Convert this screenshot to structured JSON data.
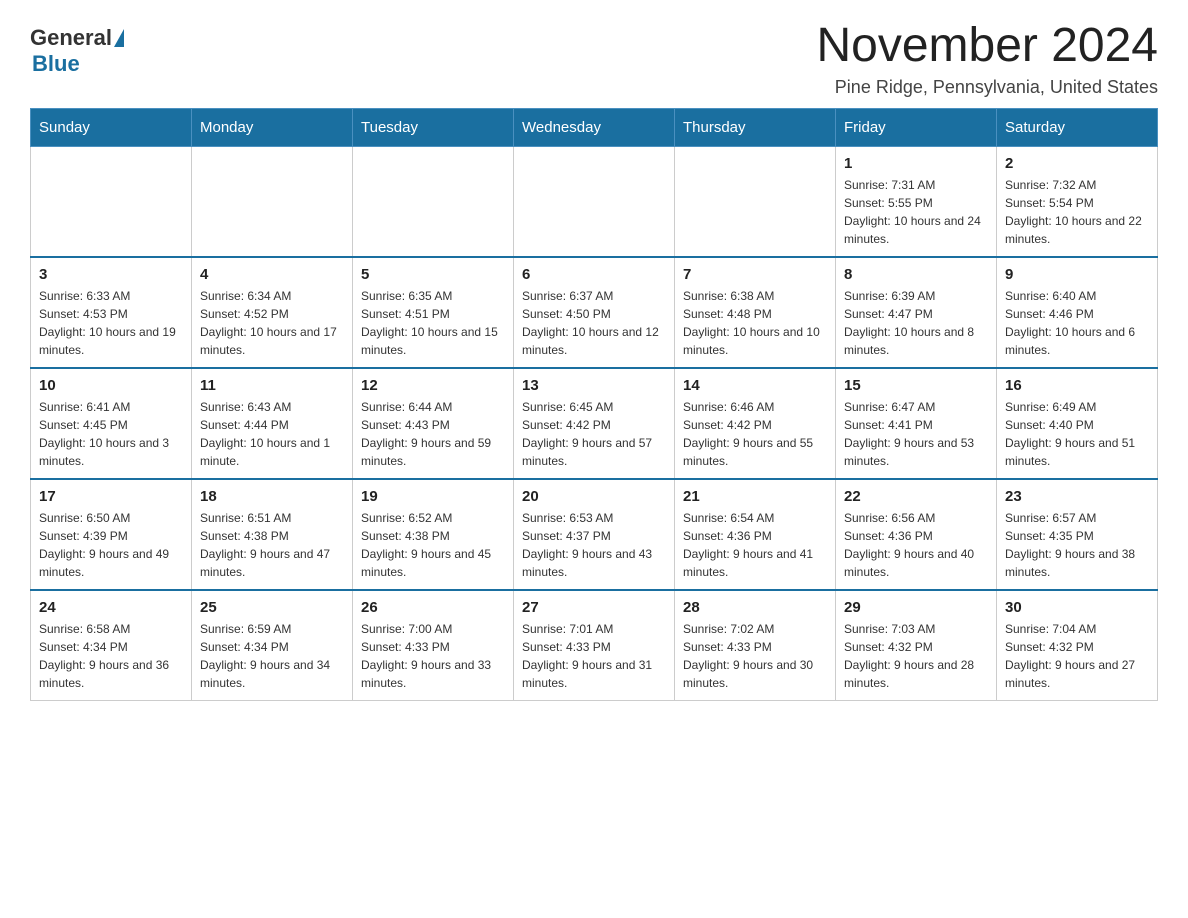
{
  "header": {
    "logo": {
      "general": "General",
      "blue": "Blue"
    },
    "title": "November 2024",
    "location": "Pine Ridge, Pennsylvania, United States"
  },
  "days_of_week": [
    "Sunday",
    "Monday",
    "Tuesday",
    "Wednesday",
    "Thursday",
    "Friday",
    "Saturday"
  ],
  "weeks": [
    [
      {
        "day": "",
        "info": ""
      },
      {
        "day": "",
        "info": ""
      },
      {
        "day": "",
        "info": ""
      },
      {
        "day": "",
        "info": ""
      },
      {
        "day": "",
        "info": ""
      },
      {
        "day": "1",
        "info": "Sunrise: 7:31 AM\nSunset: 5:55 PM\nDaylight: 10 hours and 24 minutes."
      },
      {
        "day": "2",
        "info": "Sunrise: 7:32 AM\nSunset: 5:54 PM\nDaylight: 10 hours and 22 minutes."
      }
    ],
    [
      {
        "day": "3",
        "info": "Sunrise: 6:33 AM\nSunset: 4:53 PM\nDaylight: 10 hours and 19 minutes."
      },
      {
        "day": "4",
        "info": "Sunrise: 6:34 AM\nSunset: 4:52 PM\nDaylight: 10 hours and 17 minutes."
      },
      {
        "day": "5",
        "info": "Sunrise: 6:35 AM\nSunset: 4:51 PM\nDaylight: 10 hours and 15 minutes."
      },
      {
        "day": "6",
        "info": "Sunrise: 6:37 AM\nSunset: 4:50 PM\nDaylight: 10 hours and 12 minutes."
      },
      {
        "day": "7",
        "info": "Sunrise: 6:38 AM\nSunset: 4:48 PM\nDaylight: 10 hours and 10 minutes."
      },
      {
        "day": "8",
        "info": "Sunrise: 6:39 AM\nSunset: 4:47 PM\nDaylight: 10 hours and 8 minutes."
      },
      {
        "day": "9",
        "info": "Sunrise: 6:40 AM\nSunset: 4:46 PM\nDaylight: 10 hours and 6 minutes."
      }
    ],
    [
      {
        "day": "10",
        "info": "Sunrise: 6:41 AM\nSunset: 4:45 PM\nDaylight: 10 hours and 3 minutes."
      },
      {
        "day": "11",
        "info": "Sunrise: 6:43 AM\nSunset: 4:44 PM\nDaylight: 10 hours and 1 minute."
      },
      {
        "day": "12",
        "info": "Sunrise: 6:44 AM\nSunset: 4:43 PM\nDaylight: 9 hours and 59 minutes."
      },
      {
        "day": "13",
        "info": "Sunrise: 6:45 AM\nSunset: 4:42 PM\nDaylight: 9 hours and 57 minutes."
      },
      {
        "day": "14",
        "info": "Sunrise: 6:46 AM\nSunset: 4:42 PM\nDaylight: 9 hours and 55 minutes."
      },
      {
        "day": "15",
        "info": "Sunrise: 6:47 AM\nSunset: 4:41 PM\nDaylight: 9 hours and 53 minutes."
      },
      {
        "day": "16",
        "info": "Sunrise: 6:49 AM\nSunset: 4:40 PM\nDaylight: 9 hours and 51 minutes."
      }
    ],
    [
      {
        "day": "17",
        "info": "Sunrise: 6:50 AM\nSunset: 4:39 PM\nDaylight: 9 hours and 49 minutes."
      },
      {
        "day": "18",
        "info": "Sunrise: 6:51 AM\nSunset: 4:38 PM\nDaylight: 9 hours and 47 minutes."
      },
      {
        "day": "19",
        "info": "Sunrise: 6:52 AM\nSunset: 4:38 PM\nDaylight: 9 hours and 45 minutes."
      },
      {
        "day": "20",
        "info": "Sunrise: 6:53 AM\nSunset: 4:37 PM\nDaylight: 9 hours and 43 minutes."
      },
      {
        "day": "21",
        "info": "Sunrise: 6:54 AM\nSunset: 4:36 PM\nDaylight: 9 hours and 41 minutes."
      },
      {
        "day": "22",
        "info": "Sunrise: 6:56 AM\nSunset: 4:36 PM\nDaylight: 9 hours and 40 minutes."
      },
      {
        "day": "23",
        "info": "Sunrise: 6:57 AM\nSunset: 4:35 PM\nDaylight: 9 hours and 38 minutes."
      }
    ],
    [
      {
        "day": "24",
        "info": "Sunrise: 6:58 AM\nSunset: 4:34 PM\nDaylight: 9 hours and 36 minutes."
      },
      {
        "day": "25",
        "info": "Sunrise: 6:59 AM\nSunset: 4:34 PM\nDaylight: 9 hours and 34 minutes."
      },
      {
        "day": "26",
        "info": "Sunrise: 7:00 AM\nSunset: 4:33 PM\nDaylight: 9 hours and 33 minutes."
      },
      {
        "day": "27",
        "info": "Sunrise: 7:01 AM\nSunset: 4:33 PM\nDaylight: 9 hours and 31 minutes."
      },
      {
        "day": "28",
        "info": "Sunrise: 7:02 AM\nSunset: 4:33 PM\nDaylight: 9 hours and 30 minutes."
      },
      {
        "day": "29",
        "info": "Sunrise: 7:03 AM\nSunset: 4:32 PM\nDaylight: 9 hours and 28 minutes."
      },
      {
        "day": "30",
        "info": "Sunrise: 7:04 AM\nSunset: 4:32 PM\nDaylight: 9 hours and 27 minutes."
      }
    ]
  ]
}
